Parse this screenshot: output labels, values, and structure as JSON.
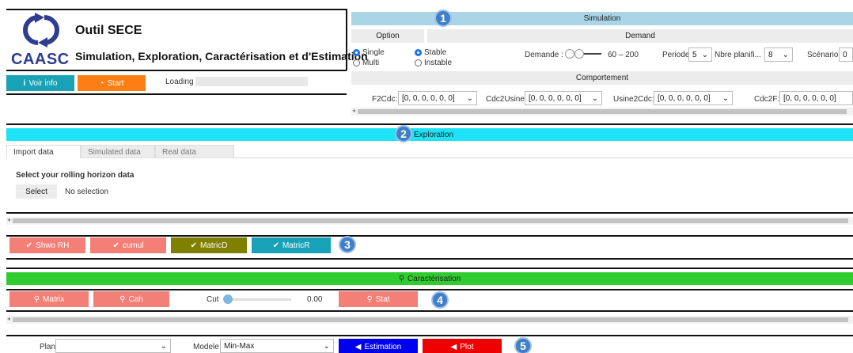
{
  "header": {
    "title": "Outil SECE",
    "subtitle": "Simulation, Exploration, Caractérisation et d'Estimation",
    "logo_text": "CAASC",
    "voir_info_label": "Voir info",
    "start_label": "Start",
    "loading_label": "Loading"
  },
  "badges": [
    "1",
    "2",
    "3",
    "4",
    "5"
  ],
  "simulation": {
    "title": "Simulation",
    "option_header": "Option",
    "demand_header": "Demand",
    "options": [
      "Single",
      "Multi"
    ],
    "stability": [
      "Stable",
      "Instable"
    ],
    "demande_label": "Demande :",
    "demande_range": "60 – 200",
    "periode_label": "Periode",
    "periode_value": "5",
    "nbre_label": "Nbre planifi...",
    "nbre_value": "8",
    "scenario_label": "Scénario",
    "scenario_value": "0",
    "comportement_title": "Comportement",
    "fields": [
      {
        "label": "F2Cdc:",
        "value": "[0, 0, 0, 0, 0, 0]"
      },
      {
        "label": "Cdc2Usine:",
        "value": "[0, 0, 0, 0, 0, 0]"
      },
      {
        "label": "Usine2Cdc:",
        "value": "[0, 0, 0, 0, 0, 0]"
      },
      {
        "label": "Cdc2F:",
        "value": "[0, 0, 0, 0, 0, 0]"
      }
    ]
  },
  "exploration": {
    "title": "Exploration",
    "tabs": [
      "Import data",
      "Simulated data",
      "Real data"
    ],
    "select_prompt": "Select your rolling horizon data",
    "select_button": "Select",
    "no_selection": "No selection"
  },
  "matrix_buttons": [
    {
      "label": "Shwo RH",
      "color": "#f47f77"
    },
    {
      "label": "cumul",
      "color": "#f47f77"
    },
    {
      "label": "MatricD",
      "color": "#7f7f00"
    },
    {
      "label": "MatricR",
      "color": "#17a2b8"
    }
  ],
  "caracterisation": {
    "title": "Caractérisation",
    "matrix_label": "Matrix",
    "cah_label": "Cah",
    "cut_label": "Cut",
    "cut_value": "0.00",
    "cut_fraction": 0.0,
    "stat_label": "Stat"
  },
  "estimation": {
    "plan_label": "Plan",
    "plan_value": "",
    "modele_label": "Modele",
    "modele_value": "Min-Max",
    "estimation_button": "Estimation",
    "plot_button": "Plot"
  },
  "colors": {
    "teal": "#17a2b8",
    "orange": "#fd7e14",
    "light_blue": "#a9d5e6",
    "cyan": "#1ee3f6",
    "green": "#2ecc2e",
    "salmon": "#f47f77",
    "olive": "#7f7f00",
    "blue": "#0000ee",
    "red": "#ee0000"
  }
}
